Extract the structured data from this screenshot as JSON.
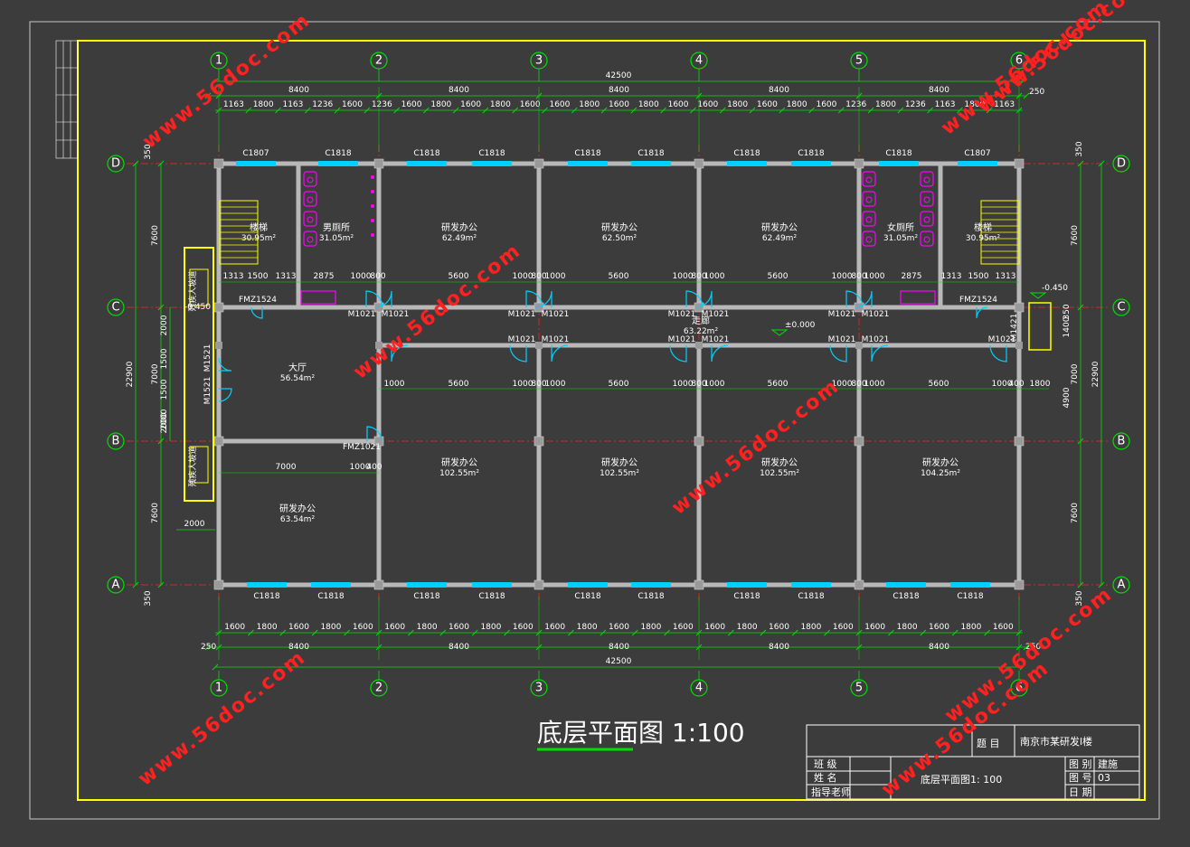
{
  "drawing": {
    "title": "底层平面图 1:100",
    "axes_x": [
      "1",
      "2",
      "3",
      "4",
      "5",
      "6"
    ],
    "axes_y": [
      "D",
      "C",
      "B",
      "A"
    ],
    "total_width": "42500",
    "bay_widths": [
      "8400",
      "8400",
      "8400",
      "8400",
      "8400"
    ],
    "top_sub_dims": [
      "1163",
      "1800",
      "1163",
      "1236",
      "1600",
      "1236",
      "1600",
      "1800",
      "1600",
      "1800",
      "1600",
      "1600",
      "1800",
      "1600",
      "1800",
      "1600",
      "1600",
      "1800",
      "1600",
      "1800",
      "1600",
      "1236",
      "1800",
      "1236",
      "1163",
      "1800",
      "1163"
    ],
    "bottom_sub_dims": [
      "1600",
      "1800",
      "1600",
      "1800",
      "1600",
      "1600",
      "1800",
      "1600",
      "1800",
      "1600",
      "1600",
      "1800",
      "1600",
      "1800",
      "1600",
      "1600",
      "1800",
      "1600",
      "1800",
      "1600",
      "1600",
      "1800",
      "1600",
      "1800",
      "1600"
    ],
    "edge_offset": "250",
    "left_dims": [
      "7600",
      "7000",
      "7600",
      "22900",
      "350"
    ],
    "left_inner_dims": [
      "2000",
      "1500",
      "1500",
      "2000",
      "2000"
    ],
    "right_dims": [
      "7600",
      "7000",
      "7600",
      "22900",
      "350",
      "350",
      "4900",
      "1400",
      "350"
    ],
    "windows_top": [
      "C1807",
      "C1818",
      "C1818",
      "C1818",
      "C1818",
      "C1818",
      "C1818",
      "C1818",
      "C1818",
      "C1807"
    ],
    "windows_bottom": [
      "C1818",
      "C1818",
      "C1818",
      "C1818",
      "C1818",
      "C1818",
      "C1818",
      "C1818",
      "C1818",
      "C1818"
    ],
    "rooms": [
      {
        "name": "楼梯",
        "area": "30.95m²"
      },
      {
        "name": "男厕所",
        "area": "31.05m²"
      },
      {
        "name": "研发办公",
        "area": "62.49m²"
      },
      {
        "name": "研发办公",
        "area": "62.50m²"
      },
      {
        "name": "研发办公",
        "area": "62.49m²"
      },
      {
        "name": "女厕所",
        "area": "31.05m²"
      },
      {
        "name": "楼梯",
        "area": "30.95m²"
      },
      {
        "name": "大厅",
        "area": "56.54m²"
      },
      {
        "name": "走廊",
        "area": "63.22m²"
      },
      {
        "name": "研发办公",
        "area": "102.55m²"
      },
      {
        "name": "研发办公",
        "area": "102.55m²"
      },
      {
        "name": "研发办公",
        "area": "102.55m²"
      },
      {
        "name": "研发办公",
        "area": "104.25m²"
      },
      {
        "name": "研发办公",
        "area": "63.54m²"
      }
    ],
    "doors": [
      "FMZ1524",
      "FMZ1524",
      "M1021",
      "M1021",
      "M1521",
      "M1521",
      "FMZ1021",
      "M1421"
    ],
    "corridor_dims_upper": [
      "1313",
      "1500",
      "1313",
      "2875",
      "1000",
      "800",
      "5600",
      "1000",
      "800",
      "1000",
      "5600",
      "1000",
      "800",
      "1000",
      "5600",
      "1000",
      "800",
      "1000",
      "2875",
      "1313",
      "1500",
      "1313"
    ],
    "corridor_dims_lower": [
      "1000",
      "5600",
      "1000",
      "800",
      "1000",
      "5600",
      "1000",
      "800",
      "1000",
      "5600",
      "1000",
      "800",
      "1000",
      "5600",
      "1000",
      "400",
      "1800"
    ],
    "hall_dims": [
      "7000",
      "1000",
      "400",
      "2000"
    ],
    "levels": [
      "-0.450",
      "-0.450",
      "±0.000"
    ],
    "ramp_label": "残疾人坡道",
    "watermark": "www.56doc.com"
  },
  "title_block": {
    "project_label": "题 目",
    "project": "南京市某研发l楼",
    "drawing_name": "底层平面图1: 100",
    "class_label": "班 级",
    "name_label": "姓 名",
    "advisor_label": "指导老师",
    "type_label": "图 别",
    "type_value": "建施",
    "number_label": "图 号",
    "number_value": "03",
    "date_label": "日 期"
  },
  "colors": {
    "background": "#3c3c3c",
    "frame": "#ffff00",
    "grid_line": "#ff2020",
    "dimension": "#00e000",
    "wall": "#b8b8b8",
    "window": "#00d0ff",
    "fixture": "#ff00ff",
    "watermark": "#ff2020"
  }
}
